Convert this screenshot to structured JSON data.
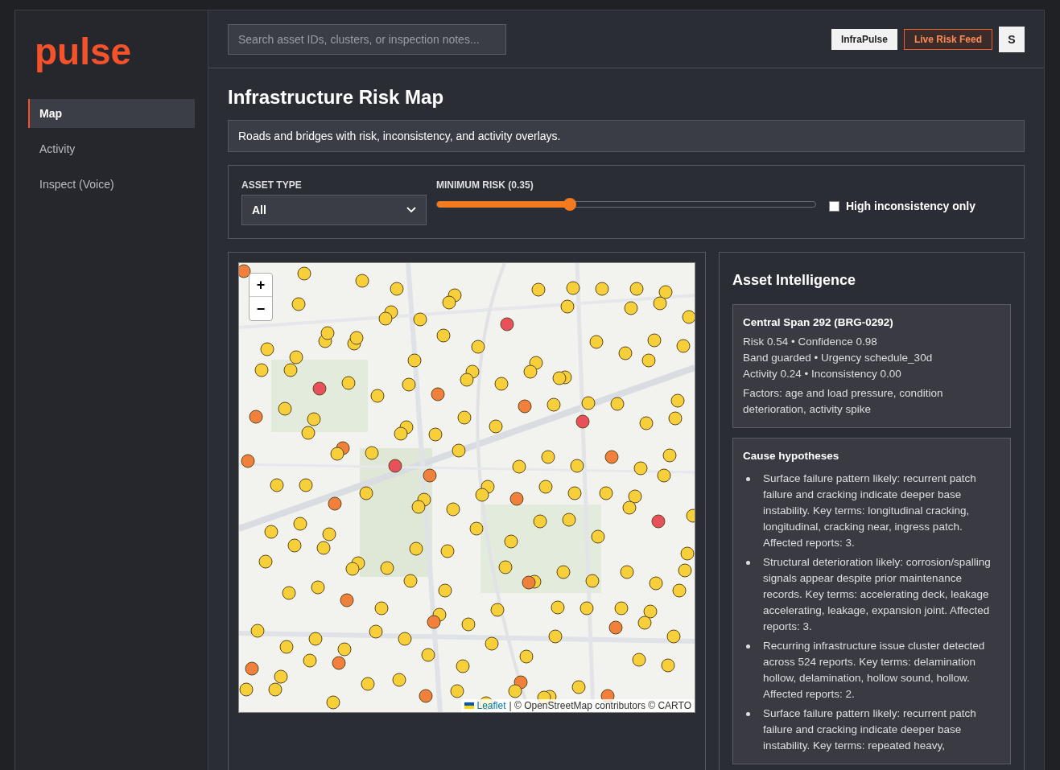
{
  "brand": {
    "logo": "pulse"
  },
  "nav": [
    {
      "label": "Map",
      "selected": true
    },
    {
      "label": "Activity",
      "selected": false
    },
    {
      "label": "Inspect (Voice)",
      "selected": false
    }
  ],
  "topbar": {
    "search": {
      "placeholder": "Search asset IDs, clusters, or inspection notes..."
    },
    "buttons": [
      {
        "label": "InfraPulse",
        "kind": "plain"
      },
      {
        "label": "Live Risk Feed",
        "kind": "accent"
      },
      {
        "label": "S",
        "kind": "avatar"
      }
    ]
  },
  "page": {
    "title": "Infrastructure Risk Map",
    "subtitle": "Roads and bridges with risk, inconsistency, and activity overlays."
  },
  "filters": {
    "asset_type": {
      "label": "ASSET TYPE",
      "value": "All"
    },
    "min_risk": {
      "label": "MINIMUM RISK (0.35)",
      "level": 0.35
    },
    "high_inconsistency": {
      "label": "High inconsistency only",
      "checked": false
    }
  },
  "map": {
    "zoom_in": "+",
    "zoom_out": "−",
    "attribution_link": "Leaflet",
    "attribution_text": "| © OpenStreetMap contributors © CARTO"
  },
  "intel": {
    "title": "Asset Intelligence",
    "asset": {
      "name": "Central Span 292 (BRG-0292)",
      "lines": [
        "Risk 0.54 • Confidence 0.98",
        "Band guarded • Urgency schedule_30d",
        "Activity 0.24 • Inconsistency 0.00"
      ],
      "factors": "Factors: age and load pressure, condition deterioration, activity spike"
    },
    "hypotheses_title": "Cause hypotheses",
    "hypotheses": [
      "Surface failure pattern likely: recurrent patch failure and cracking indicate deeper base instability. Key terms: longitudinal cracking, longitudinal, cracking near, ingress patch. Affected reports: 3.",
      "Structural deterioration likely: corrosion/spalling signals appear despite prior maintenance records. Key terms: accelerating deck, leakage accelerating, leakage, expansion joint. Affected reports: 3.",
      "Recurring infrastructure issue cluster detected across 524 reports. Key terms: delamination hollow, delamination, hollow sound, hollow. Affected reports: 2.",
      "Surface failure pattern likely: recurrent patch failure and cracking indicate deeper base instability. Key terms: repeated heavy,"
    ]
  }
}
